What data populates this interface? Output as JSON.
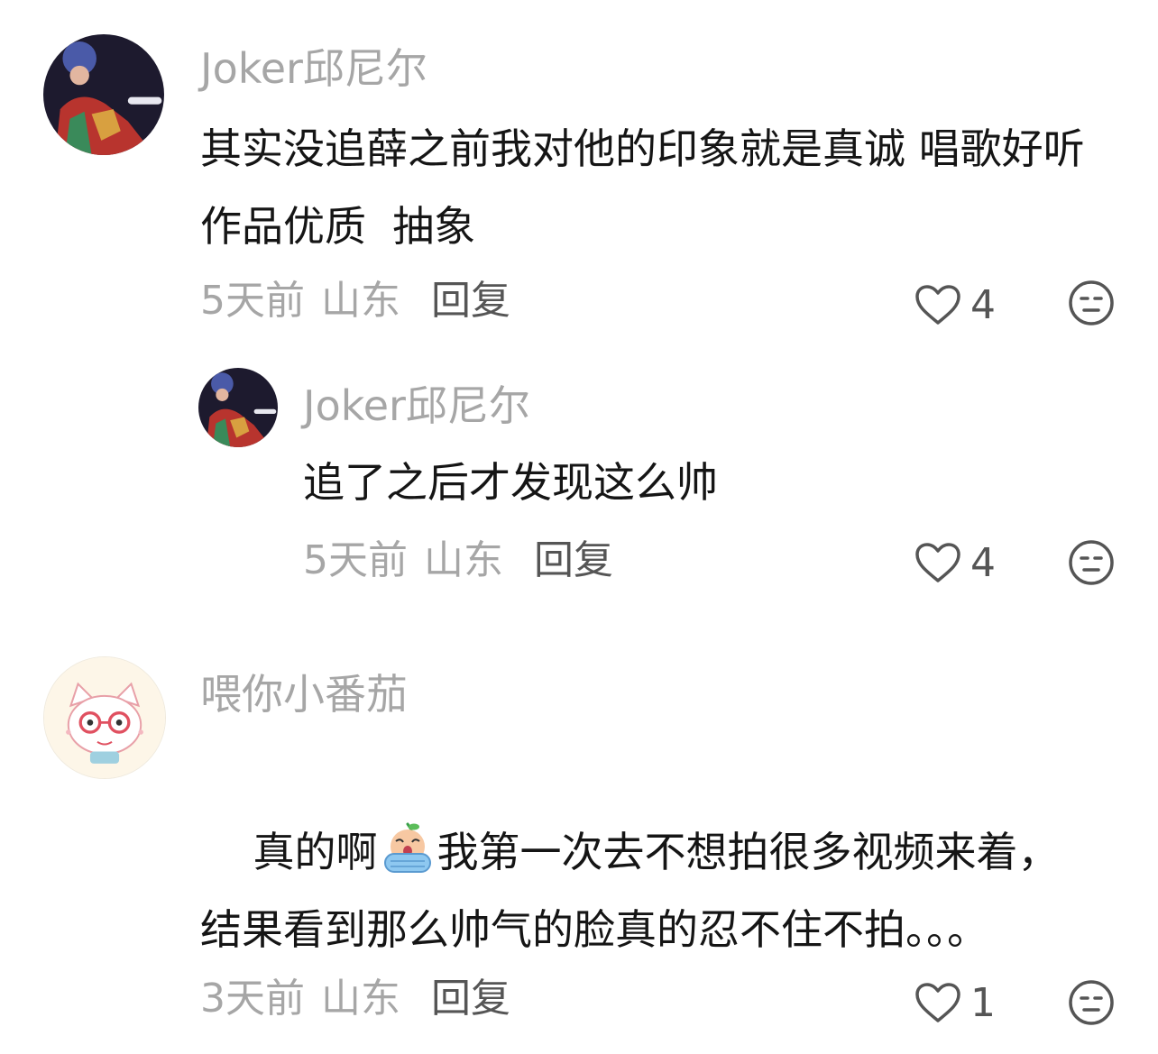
{
  "comments": [
    {
      "username": "Joker邱尼尔",
      "content": "其实没追薛之前我对他的印象就是真诚 唱歌好听  作品优质  抽象",
      "time": "5天前",
      "location": "山东",
      "reply_label": "回复",
      "likes": "4",
      "avatar_icon": "performer-photo-avatar"
    },
    {
      "username": "Joker邱尼尔",
      "content": "追了之后才发现这么帅",
      "time": "5天前",
      "location": "山东",
      "reply_label": "回复",
      "likes": "4",
      "avatar_icon": "performer-photo-avatar"
    },
    {
      "username": "喂你小番茄",
      "content_before_emoji": "真的啊",
      "inline_emoji": "crying-face-emoji",
      "content_after_emoji": "我第一次去不想拍很多视频来着，结果看到那么帅气的脸真的忍不住不拍。。。",
      "time": "3天前",
      "location": "山东",
      "reply_label": "回复",
      "likes": "1",
      "avatar_icon": "cartoon-cat-avatar"
    }
  ],
  "icons": {
    "like": "heart-outline-icon",
    "dislike": "meh-face-icon"
  },
  "colors": {
    "username": "#a6a6a6",
    "content": "#151515",
    "meta": "#a6a6a6",
    "action": "#555555"
  }
}
